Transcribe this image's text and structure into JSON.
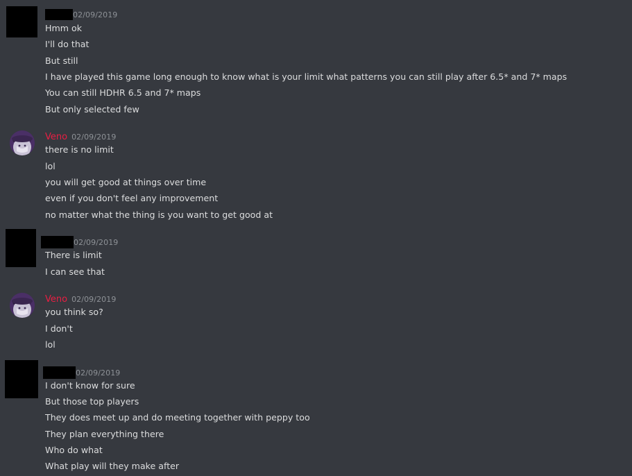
{
  "colors": {
    "background": "#36393f",
    "text": "#dcddde",
    "timestamp": "#8e9297",
    "veno_name": "#e91e43"
  },
  "groups": [
    {
      "author": "",
      "author_redacted": true,
      "timestamp": "02/09/2019",
      "messages": [
        "Hmm ok",
        "I'll do that",
        "But still",
        "I have played this game long enough to know what is your limit what patterns you can still play after 6.5* and 7* maps",
        "You can still HDHR 6.5 and 7* maps",
        "But only selected few"
      ]
    },
    {
      "author": "Veno",
      "author_redacted": false,
      "avatar_icon": "anime-avatar-icon",
      "timestamp": "02/09/2019",
      "messages": [
        "there is no limit",
        "lol",
        "you will get good at things over time",
        "even if you don't feel any improvement",
        "no matter what the thing is you want to get good at"
      ]
    },
    {
      "author": "",
      "author_redacted": true,
      "timestamp": "02/09/2019",
      "messages": [
        "There is limit",
        "I can see that"
      ]
    },
    {
      "author": "Veno",
      "author_redacted": false,
      "avatar_icon": "anime-avatar-icon",
      "timestamp": "02/09/2019",
      "messages": [
        "you think so?",
        "I don't",
        "lol"
      ]
    },
    {
      "author": "",
      "author_redacted": true,
      "timestamp": "02/09/2019",
      "messages": [
        "I don't know for sure",
        "But those top players",
        "They does meet up and do meeting together with peppy too",
        "They plan everything there",
        "Who do what",
        "What play will they make after"
      ]
    }
  ]
}
